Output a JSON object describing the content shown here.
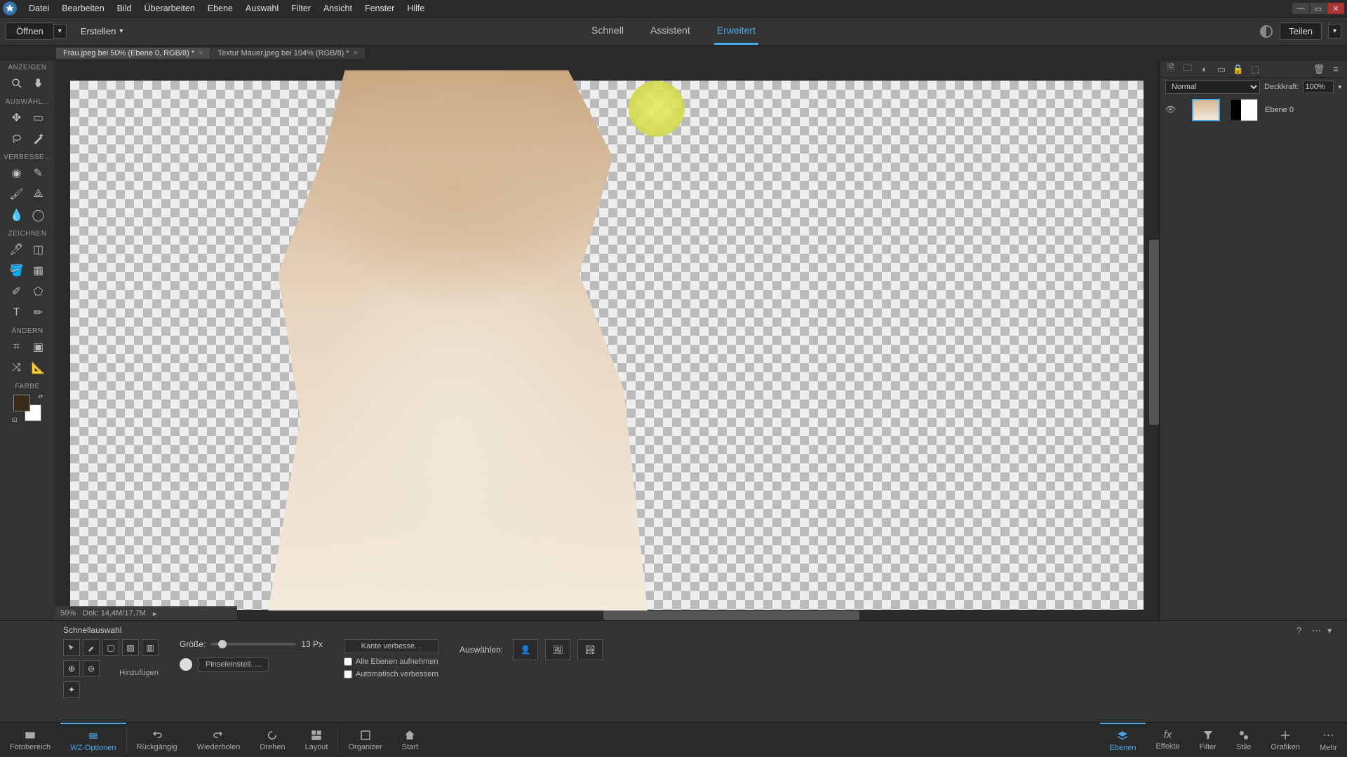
{
  "menubar": {
    "items": [
      "Datei",
      "Bearbeiten",
      "Bild",
      "Überarbeiten",
      "Ebene",
      "Auswahl",
      "Filter",
      "Ansicht",
      "Fenster",
      "Hilfe"
    ]
  },
  "secondbar": {
    "open": "Öffnen",
    "create": "Erstellen",
    "modes": {
      "quick": "Schnell",
      "guided": "Assistent",
      "expert": "Erweitert"
    },
    "share": "Teilen"
  },
  "doctabs": {
    "tab1": "Frau.jpeg bei 50% (Ebene 0, RGB/8) *",
    "tab2": "Textur Mauer.jpeg bei 104% (RGB/8) *"
  },
  "tools": {
    "view": "ANZEIGEN",
    "select": "AUSWÄHL...",
    "enhance": "VERBESSE...",
    "draw": "ZEICHNEN",
    "modify": "ÄNDERN",
    "color": "FARBE"
  },
  "status": {
    "zoom": "50%",
    "doc": "Dok: 14,4M/17,7M"
  },
  "layers": {
    "blend": "Normal",
    "opacity_label": "Deckkraft:",
    "opacity": "100%",
    "layer_name": "Ebene 0"
  },
  "options": {
    "title": "Schnellauswahl",
    "add_label": "Hinzufügen",
    "size_label": "Größe:",
    "size_value": "13 Px",
    "brush_btn": "Pinseleinstell. ...",
    "refine_btn": "Kante verbesse...",
    "all_layers": "Alle Ebenen aufnehmen",
    "auto_enhance": "Automatisch verbessern",
    "select_label": "Auswählen:"
  },
  "taskbar": {
    "photo_bin": "Fotobereich",
    "tool_opts": "WZ-Optionen",
    "undo": "Rückgängig",
    "redo": "Wiederholen",
    "rotate": "Drehen",
    "layout": "Layout",
    "organizer": "Organizer",
    "home": "Start",
    "layers": "Ebenen",
    "effects": "Effekte",
    "filters": "Filter",
    "styles": "Stile",
    "graphics": "Grafiken",
    "more": "Mehr"
  }
}
